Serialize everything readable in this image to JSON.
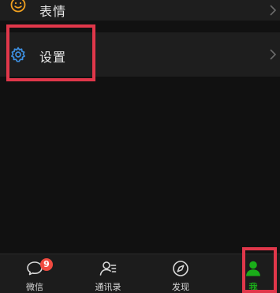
{
  "menu": {
    "emoji_label": "表情",
    "settings_label": "设置"
  },
  "tabs": [
    {
      "label": "微信",
      "icon": "chat-bubble-icon",
      "badge": "9"
    },
    {
      "label": "通讯录",
      "icon": "contacts-icon"
    },
    {
      "label": "发现",
      "icon": "compass-icon"
    },
    {
      "label": "我",
      "icon": "person-icon",
      "active": true
    }
  ],
  "colors": {
    "active_tab": "#1aad19",
    "badge": "#f04a40",
    "settings_icon": "#3d8fe0",
    "emoji_icon": "#f0a020",
    "highlight": "#e0374a"
  }
}
